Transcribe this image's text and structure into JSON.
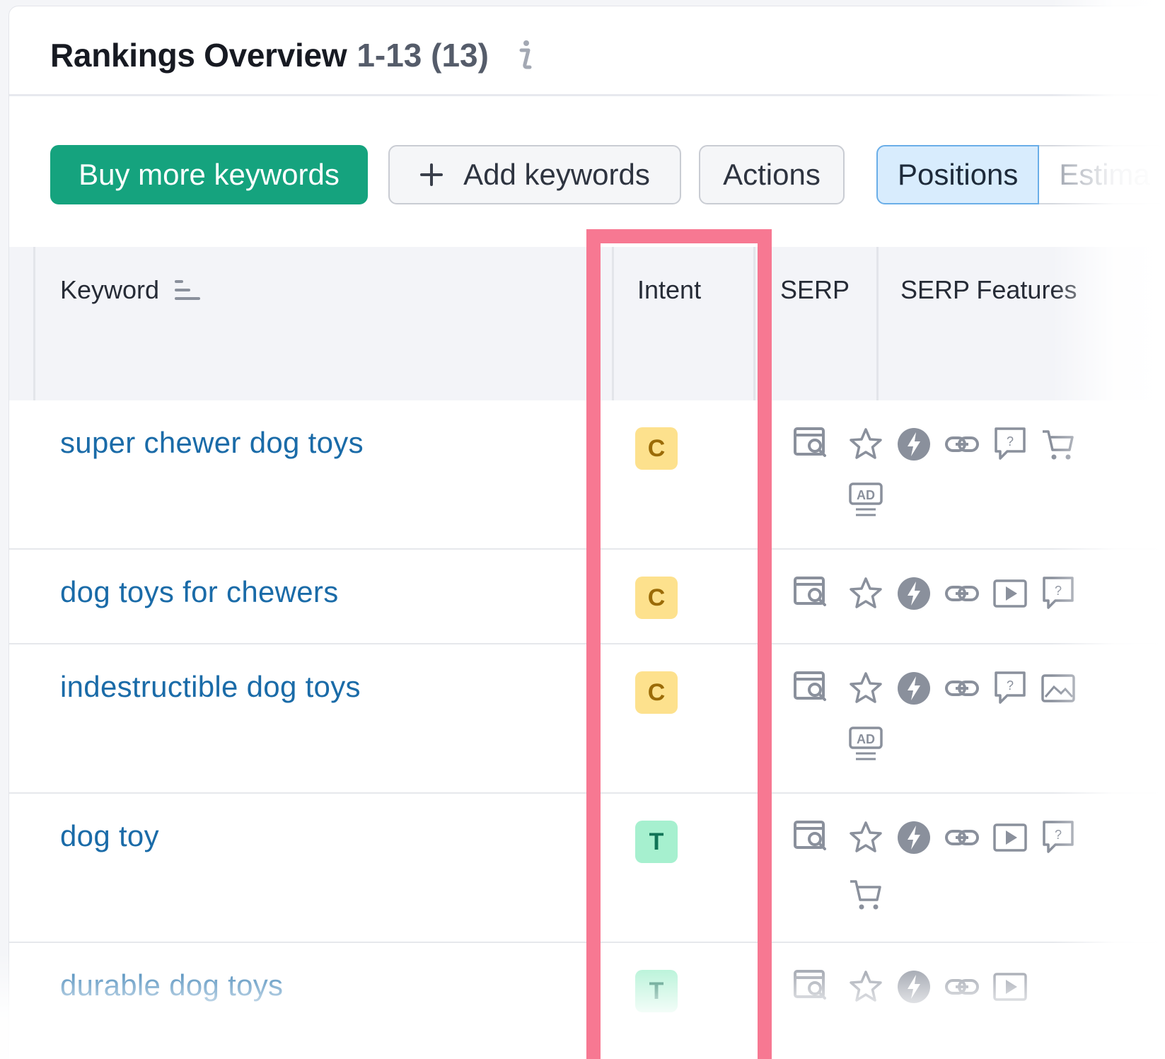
{
  "header": {
    "title": "Rankings Overview",
    "count": "1-13 (13)",
    "info_icon": "info-icon"
  },
  "toolbar": {
    "buy_label": "Buy more keywords",
    "add_label": "Add keywords",
    "add_icon": "plus-icon",
    "actions_label": "Actions",
    "view_tabs": [
      {
        "label": "Positions",
        "active": true
      },
      {
        "label": "Estima",
        "active": false
      }
    ]
  },
  "table": {
    "columns": [
      {
        "label": "Keyword",
        "icon": "sort-icon"
      },
      {
        "label": "Intent"
      },
      {
        "label": "SERP"
      },
      {
        "label": "SERP Features"
      }
    ],
    "rows": [
      {
        "keyword": "super chewer dog toys",
        "intent": "C",
        "serp_icon": "serp-preview-icon",
        "features": [
          "star-icon",
          "lightning-icon",
          "link-icon",
          "question-icon",
          "cart-icon",
          "ad-icon"
        ]
      },
      {
        "keyword": "dog toys for chewers",
        "intent": "C",
        "serp_icon": "serp-preview-icon",
        "features": [
          "star-icon",
          "lightning-icon",
          "link-icon",
          "video-icon",
          "question-icon"
        ]
      },
      {
        "keyword": "indestructible dog toys",
        "intent": "C",
        "serp_icon": "serp-preview-icon",
        "features": [
          "star-icon",
          "lightning-icon",
          "link-icon",
          "question-icon",
          "image-icon",
          "ad-icon"
        ]
      },
      {
        "keyword": "dog toy",
        "intent": "T",
        "serp_icon": "serp-preview-icon",
        "features": [
          "star-icon",
          "lightning-icon",
          "link-icon",
          "video-icon",
          "question-icon",
          "cart-icon"
        ]
      },
      {
        "keyword": "durable dog toys",
        "intent": "T",
        "serp_icon": "serp-preview-icon",
        "features": [
          "star-icon",
          "lightning-icon",
          "link-icon",
          "video-icon"
        ]
      }
    ]
  },
  "colors": {
    "primary": "#15a37e",
    "link": "#1a6ba8",
    "intent_commercial_bg": "#fde18d",
    "intent_transactional_bg": "#a6f0cf",
    "highlight": "#f77892",
    "active_tab_bg": "#d8ecfd"
  }
}
